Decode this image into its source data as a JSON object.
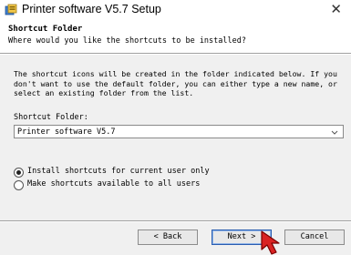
{
  "window": {
    "title": "Printer software V5.7 Setup",
    "close_glyph": "✕"
  },
  "header": {
    "title": "Shortcut Folder",
    "subtitle": "Where would you like the shortcuts to be installed?"
  },
  "description": {
    "line1": "The shortcut icons will be created in the folder indicated below. If you",
    "line2": "don't want to use the default folder, you can either type a new name, or",
    "line3": "select an existing folder from the list."
  },
  "shortcut_folder": {
    "label": "Shortcut Folder:",
    "selected_value": "Printer software V5.7",
    "dropdown_icon": "chevron-down-icon"
  },
  "options": {
    "current_user_label": "Install shortcuts for current user only",
    "current_user_selected": true,
    "all_users_label": "Make shortcuts available to all users",
    "all_users_selected": false
  },
  "buttons": {
    "back_label": "< Back",
    "next_label": "Next >",
    "cancel_label": "Cancel",
    "default_button": "next"
  },
  "colors": {
    "window_bg": "#f0f0f0",
    "header_bg": "#ffffff",
    "cursor_fill": "#d92323"
  }
}
